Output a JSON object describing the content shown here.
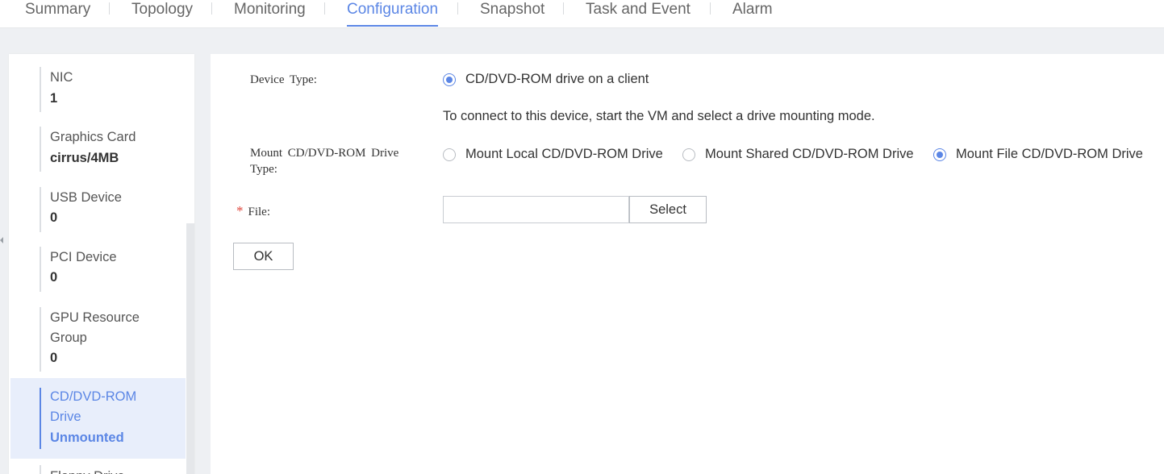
{
  "tabs": [
    {
      "label": "Summary"
    },
    {
      "label": "Topology"
    },
    {
      "label": "Monitoring"
    },
    {
      "label": "Configuration"
    },
    {
      "label": "Snapshot"
    },
    {
      "label": "Task and Event"
    },
    {
      "label": "Alarm"
    }
  ],
  "active_tab": "Configuration",
  "sidebar": {
    "items": [
      {
        "label": "NIC",
        "value": "1"
      },
      {
        "label": "Graphics Card",
        "value": "cirrus/4MB"
      },
      {
        "label": "USB Device",
        "value": "0"
      },
      {
        "label": "PCI Device",
        "value": "0"
      },
      {
        "label": "GPU Resource",
        "label2": "Group",
        "value": "0"
      },
      {
        "label": "CD/DVD-ROM",
        "label2": "Drive",
        "value": "Unmounted"
      },
      {
        "label": "Floppy Drive"
      }
    ],
    "active_item": "CD/DVD-ROM Drive"
  },
  "form": {
    "device_type_label": "Device Type:",
    "device_type_option": "CD/DVD-ROM drive on a client",
    "hint": "To connect to this device, start the VM and select a drive mounting mode.",
    "mount_type_label": "Mount CD/DVD-ROM Drive",
    "mount_type_label2": "Type:",
    "mount_options": [
      {
        "label": "Mount Local CD/DVD-ROM Drive",
        "checked": false
      },
      {
        "label": "Mount Shared CD/DVD-ROM Drive",
        "checked": false
      },
      {
        "label": "Mount File CD/DVD-ROM Drive",
        "checked": true
      }
    ],
    "required_mark": "*",
    "file_label": "File:",
    "file_value": "",
    "select_button": "Select",
    "ok_button": "OK"
  },
  "colors": {
    "accent": "#5b86e5",
    "required": "#e0473d",
    "active_bg": "#e8eefb"
  }
}
